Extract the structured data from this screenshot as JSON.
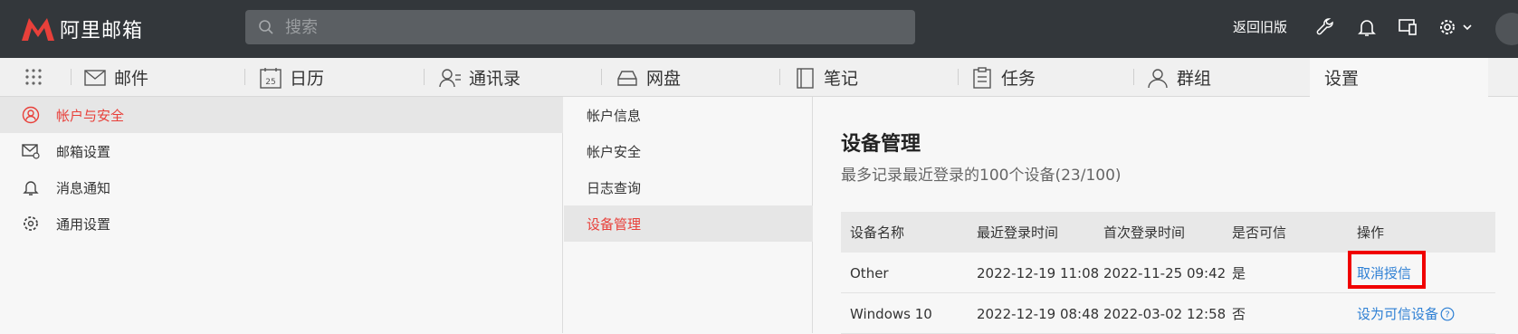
{
  "topbar": {
    "logo_text": "阿里邮箱",
    "search_placeholder": "搜索",
    "return_old_label": "返回旧版"
  },
  "nav": {
    "tabs": [
      {
        "label": "邮件"
      },
      {
        "label": "日历"
      },
      {
        "label": "通讯录"
      },
      {
        "label": "网盘"
      },
      {
        "label": "笔记"
      },
      {
        "label": "任务"
      },
      {
        "label": "群组"
      },
      {
        "label": "设置"
      }
    ],
    "calendar_day": "25"
  },
  "left_menu": {
    "items": [
      {
        "label": "帐户与安全"
      },
      {
        "label": "邮箱设置"
      },
      {
        "label": "消息通知"
      },
      {
        "label": "通用设置"
      }
    ]
  },
  "mid_menu": {
    "items": [
      {
        "label": "帐户信息"
      },
      {
        "label": "帐户安全"
      },
      {
        "label": "日志查询"
      },
      {
        "label": "设备管理"
      }
    ]
  },
  "main": {
    "title": "设备管理",
    "subtitle": "最多记录最近登录的100个设备(23/100)",
    "table": {
      "headers": [
        "设备名称",
        "最近登录时间",
        "首次登录时间",
        "是否可信",
        "操作"
      ],
      "rows": [
        {
          "name": "Other",
          "last": "2022-12-19 11:08",
          "first": "2022-11-25 09:42",
          "trusted": "是",
          "action": "取消授信"
        },
        {
          "name": "Windows 10",
          "last": "2022-12-19 08:48",
          "first": "2022-03-02 12:58",
          "trusted": "否",
          "action": "设为可信设备"
        }
      ]
    }
  },
  "colors": {
    "topbar_bg": "#33373b",
    "accent_red": "#e8403a",
    "link_blue": "#2d7fd4",
    "highlight_red": "#f00000"
  }
}
